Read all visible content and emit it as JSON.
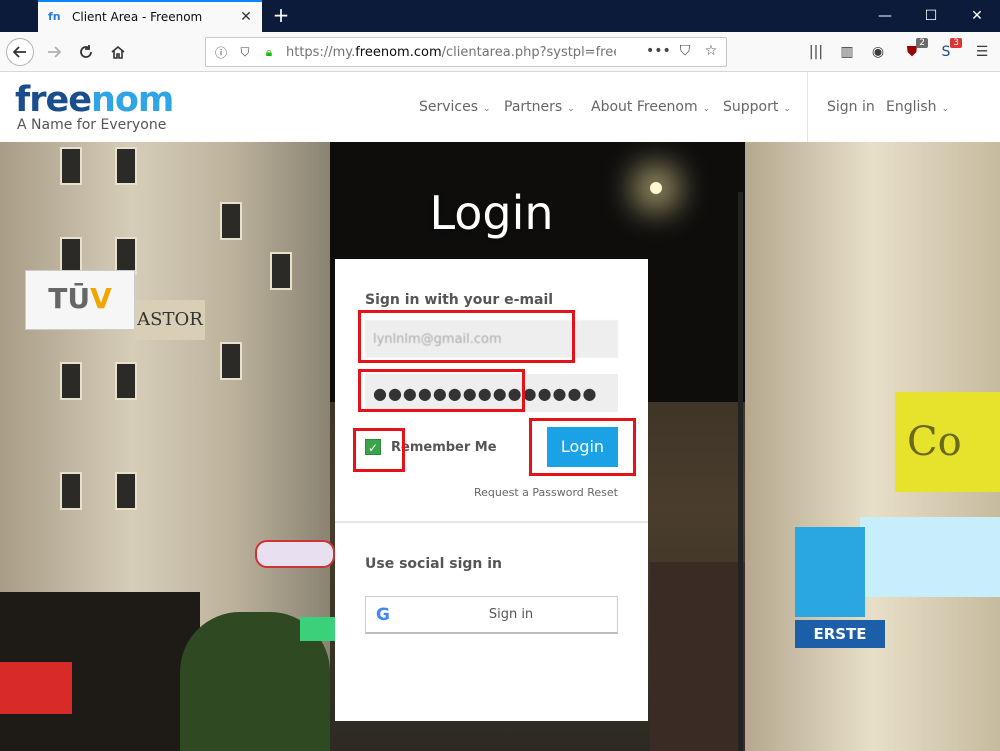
{
  "browser": {
    "tab_title": "Client Area - Freenom",
    "tab_favicon": "fn",
    "url_prefix": "https://my.",
    "url_domain": "freenom.com",
    "url_path": "/clientarea.php?systpl=freenon",
    "badge_ublock": "2",
    "badge_ext": "3"
  },
  "site": {
    "logo_part1": "free",
    "logo_part2": "nom",
    "tagline": "A Name for Everyone",
    "nav": [
      {
        "label": "Services"
      },
      {
        "label": "Partners"
      },
      {
        "label": "About Freenom"
      },
      {
        "label": "Support"
      }
    ],
    "signin": "Sign in",
    "language": "English"
  },
  "background": {
    "tuv_part1": "TŪ",
    "tuv_part2": "V",
    "astor": "ASTOR",
    "yellow_sign": "Co",
    "erste": "ERSTE"
  },
  "login": {
    "title": "Login",
    "subtitle": "Sign in with your e-mail",
    "email_value": "lynlnlm@gmail.com",
    "password_value": "●●●●●●●●●●●●●●●",
    "remember_label": "Remember Me",
    "remember_checked": true,
    "login_button": "Login",
    "reset_link": "Request a Password Reset",
    "social_title": "Use social sign in",
    "google_label": "Sign in",
    "google_icon": "G"
  },
  "colors": {
    "accent": "#1ba2e6",
    "highlight": "#e5121a",
    "checkbox": "#3aa34b"
  }
}
